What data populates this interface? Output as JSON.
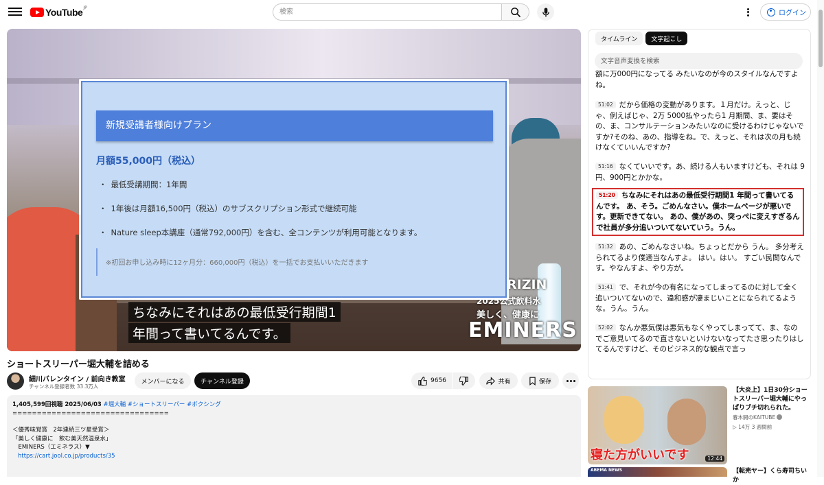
{
  "header": {
    "logo_text": "YouTube",
    "logo_region": "JP",
    "search_placeholder": "検索",
    "login_label": "ログイン"
  },
  "video": {
    "overlay": {
      "plan_header": "新規受講者様向けプラン",
      "price": "月額55,000円（税込）",
      "bullets": [
        "最低受講期間：1年間",
        "1年後は月額16,500円（税込）のサブスクリプション形式で継続可能",
        "Nature sleep本講座（通常792,000円）を含む、全コンテンツが利用可能となります。"
      ],
      "note": "※初回お申し込み時に12ヶ月分：660,000円（税込）を一括でお支払いいただきます"
    },
    "brand": {
      "rizin": "RIZIN",
      "line1": "2025公式飲料水",
      "line2": "美しく、健康に",
      "name": "EMINERS"
    },
    "captions": [
      "ちなみにそれはあの最低受行期間1",
      "年間って書いてるんです。"
    ]
  },
  "meta": {
    "title": "ショートスリーパー堀大輔を詰める",
    "channel_name": "細川バレンタイン / 前向き教室",
    "subscribers": "チャンネル登録者数 33.3万人",
    "member_label": "メンバーになる",
    "subscribe_label": "チャンネル登録",
    "like_count": "9656",
    "share_label": "共有",
    "save_label": "保存"
  },
  "description": {
    "views_date": "1,405,599回視聴  2025/06/03",
    "tags": [
      "#堀大輔",
      "#ショートスリーパー",
      "#ボクシング"
    ],
    "separator": "================================",
    "lines": [
      "＜優秀味覚賞　2年連続三ツ星受賞＞",
      "「美しく健康に　飲む美天然温泉水」",
      "　EMINERS（エミネラス）▼"
    ],
    "link": "https://cart.jool.co.jp/products/35"
  },
  "transcript": {
    "tabs": [
      "タイムライン",
      "文字起こし"
    ],
    "search_placeholder": "文字音声変換を検索",
    "partial": "額に万000円になってる みたいなのが今のスタイルなんですよね。",
    "segments": [
      {
        "time": "51:02",
        "text": "だから価格の変動があります。１月だけ。えっと、じゃ、例えばじゃ、2万 5000払やったら1 月期間、ま、要はその、ま、コンサルテーションみたいなのに受けるわけじゃないですか?そのね、あの、指導をね。で、えっと、それは次の月も続けなくていいんですか?"
      },
      {
        "time": "51:16",
        "text": "なくていいです。あ、続ける人もいますけども、それは 9円、900円とかかな。"
      },
      {
        "time": "51:20",
        "text": "ちなみにそれはあの最低受行期間1 年間って書いてるんです。 あ、そう。ごめんなさい。僕ホームページが悪いです。更新できてない。 あの、僕があの、突っぺに変えすぎるんで社員が多分追いついてないていう。うん。"
      },
      {
        "time": "51:32",
        "text": "あの、ごめんなさいね。ちょっとだから うん。 多分考えられてるより僕適当なんすよ。 はい。はい。 すごい民間なんです。やなんすよ、やり方が。"
      },
      {
        "time": "51:41",
        "text": "で、それが今の有名になってしまってるのに対して全く追いついてないので、違和感が凄まじいことになられてるような。うん。うん。"
      },
      {
        "time": "52:02",
        "text": "なんか悪気僕は悪気もなくやってしまってて、ま、なのでご意見いてるので直さないといけないなってたさ思ったりはしてるんですけど、そのビジネス的な観点で言っ"
      }
    ]
  },
  "recommendations": [
    {
      "title": "【大炎上】1日30分ショートスリーパー堀大輔にやっぱりブチ切れられた。",
      "channel": "春木開のKAITUBE",
      "meta": "14万  3 週間前",
      "duration": "12:44",
      "thumb_text": "寝た方がいいです"
    },
    {
      "title": "【転売ヤー】くら寿司ちいか",
      "thumb_text": "ABEMA NEWS"
    }
  ]
}
